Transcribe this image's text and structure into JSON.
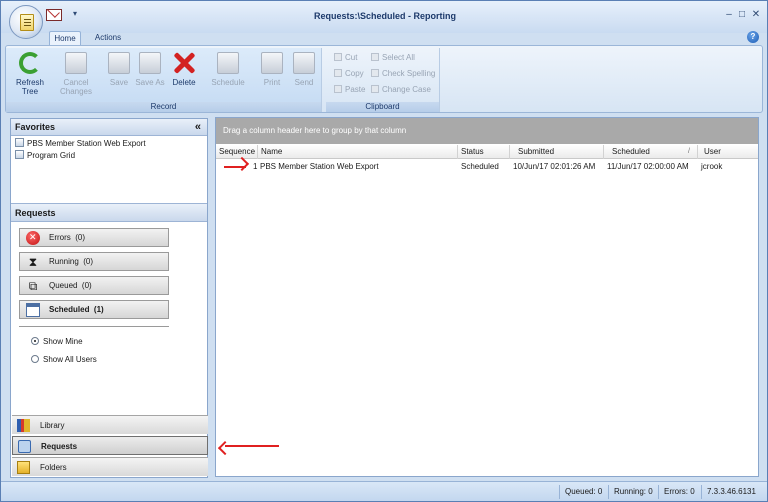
{
  "title": "Requests:\\Scheduled - Reporting",
  "qat": {
    "dropdown": "▾"
  },
  "window_controls": {
    "minimize": "–",
    "maximize": "□",
    "close": "✕"
  },
  "tabs": [
    {
      "label": "Home"
    },
    {
      "label": "Actions"
    }
  ],
  "help": "?",
  "ribbon": {
    "record": {
      "label": "Record",
      "buttons": [
        {
          "label": "Refresh Tree",
          "enabled": true,
          "icon": "refresh-icon"
        },
        {
          "label": "Cancel Changes",
          "enabled": false,
          "icon": "cancel-changes-icon"
        },
        {
          "label": "Save",
          "enabled": false,
          "icon": "save-icon"
        },
        {
          "label": "Save As",
          "enabled": false,
          "icon": "save-as-icon"
        },
        {
          "label": "Delete",
          "enabled": true,
          "icon": "delete-icon"
        },
        {
          "label": "Schedule",
          "enabled": false,
          "icon": "schedule-icon"
        },
        {
          "label": "Print",
          "enabled": false,
          "icon": "print-icon"
        },
        {
          "label": "Send",
          "enabled": false,
          "icon": "send-icon"
        }
      ]
    },
    "clipboard": {
      "label": "Clipboard",
      "cut": "Cut",
      "copy": "Copy",
      "paste": "Paste",
      "select_all": "Select All",
      "check_spelling": "Check Spelling",
      "change_case": "Change Case"
    }
  },
  "favorites": {
    "header": "Favorites",
    "collapse": "«",
    "items": [
      "PBS Member Station Web Export",
      "Program Grid"
    ]
  },
  "requests": {
    "header": "Requests",
    "buttons": [
      {
        "label": "Errors",
        "count": "(0)"
      },
      {
        "label": "Running",
        "count": "(0)"
      },
      {
        "label": "Queued",
        "count": "(0)"
      },
      {
        "label": "Scheduled",
        "count": "(1)"
      }
    ],
    "filters": [
      {
        "label": "Show Mine",
        "selected": true
      },
      {
        "label": "Show All Users",
        "selected": false
      }
    ]
  },
  "nav": [
    "Library",
    "Requests",
    "Folders"
  ],
  "grid": {
    "group_prompt": "Drag a column header here to group by that column",
    "columns": [
      "Sequence",
      "Name",
      "Status",
      "Submitted",
      "Scheduled",
      "User"
    ],
    "sort_glyph": "/",
    "rows": [
      {
        "sequence": "1",
        "name": "PBS Member Station Web Export",
        "status": "Scheduled",
        "submitted": "10/Jun/17 02:01:26 AM",
        "scheduled": "11/Jun/17 02:00:00 AM",
        "user": "jcrook"
      }
    ]
  },
  "statusbar": {
    "queued": "Queued: 0",
    "running": "Running: 0",
    "errors": "Errors: 0",
    "version": "7.3.3.46.6131"
  },
  "colors": {
    "accent": "#1d3a6b",
    "arrow": "#e02020",
    "ribbon": "#d7e5f4"
  }
}
